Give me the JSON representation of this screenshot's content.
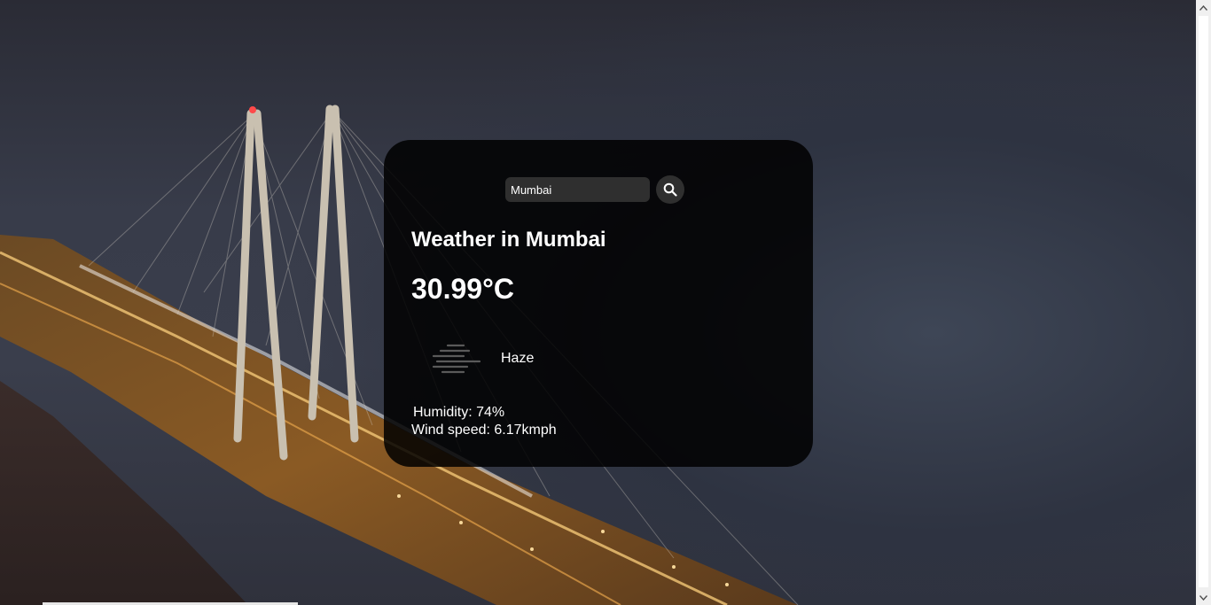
{
  "search": {
    "value": "Mumbai",
    "button_icon": "search-icon"
  },
  "weather": {
    "title": "Weather in Mumbai",
    "temperature": "30.99°C",
    "condition_icon": "haze-icon",
    "description": "Haze",
    "humidity": "Humidity: 74%",
    "wind": "Wind speed: 6.17kmph"
  },
  "colors": {
    "card_background": "#000000",
    "text": "#ffffff",
    "input_background": "#2f2f2f"
  }
}
